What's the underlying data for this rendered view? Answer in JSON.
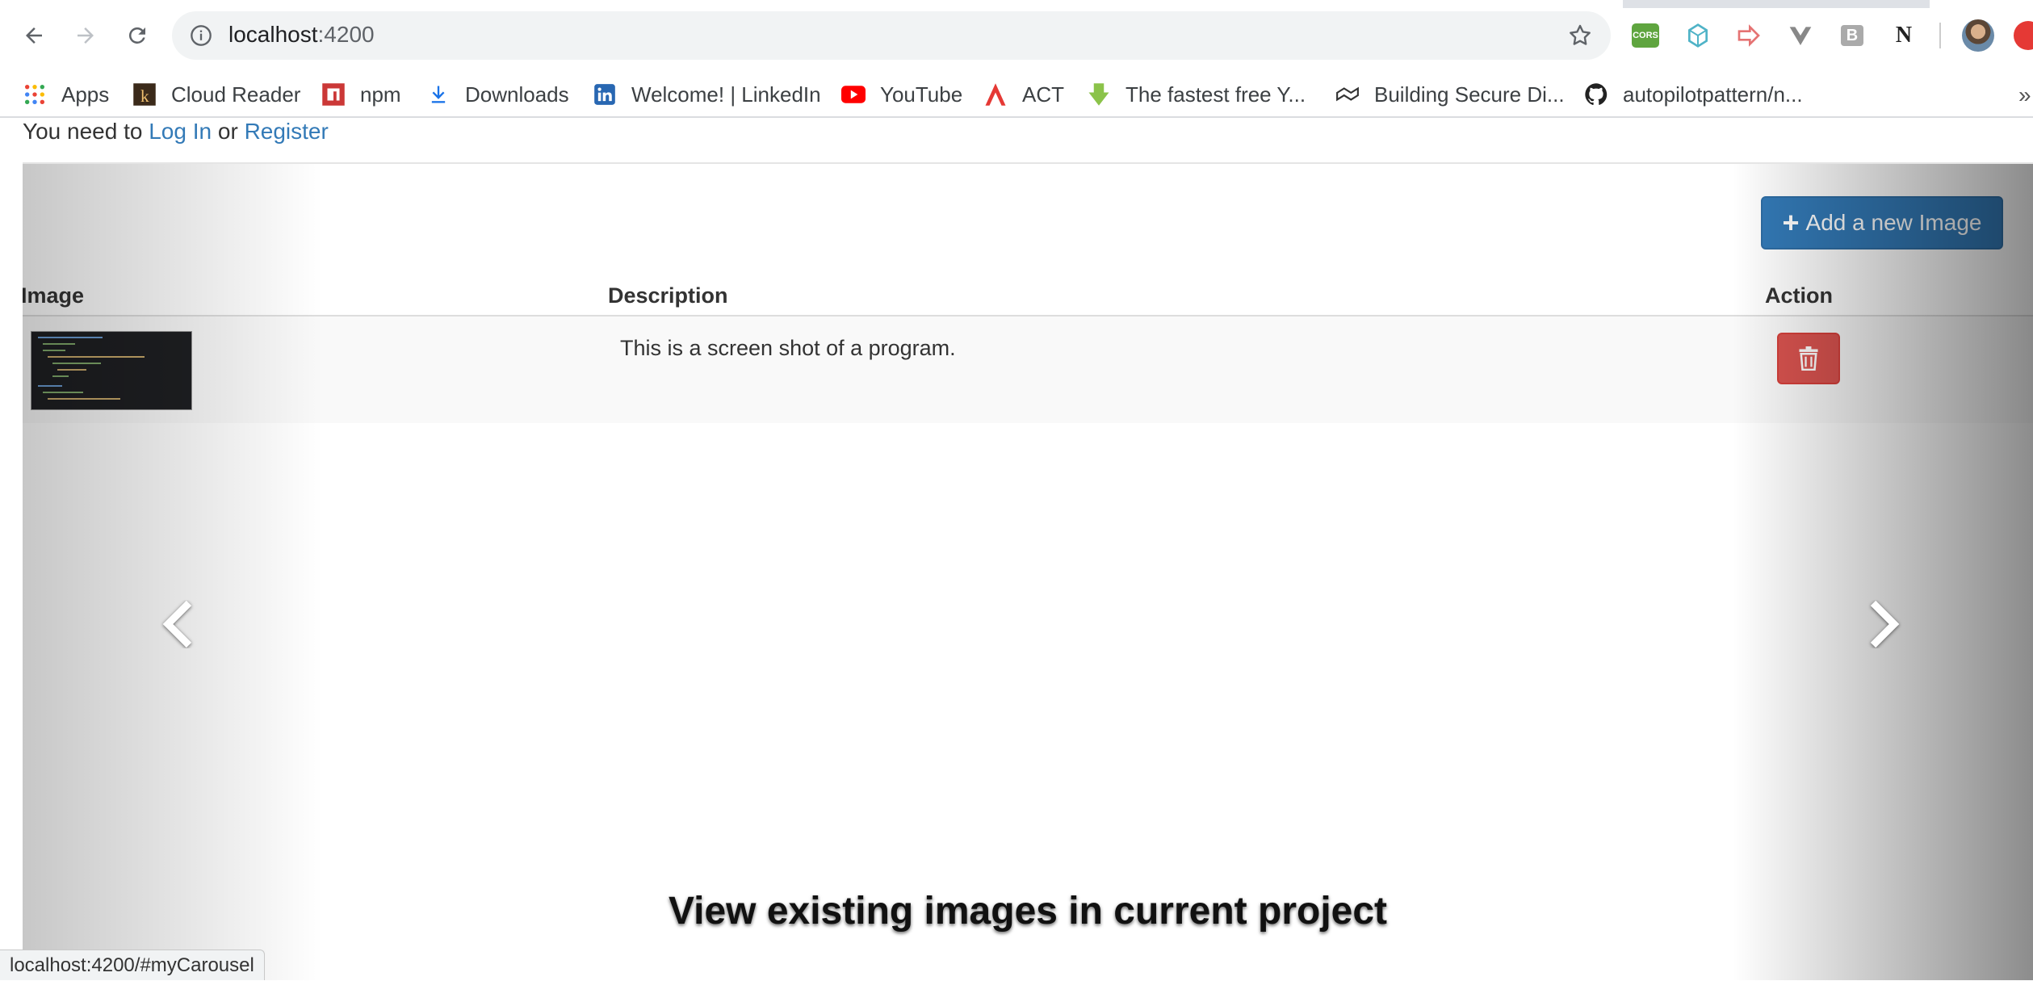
{
  "browser": {
    "url_host": "localhost",
    "url_port": ":4200",
    "bookmarks": [
      {
        "label": "Apps",
        "icon": "apps-grid-icon"
      },
      {
        "label": "Cloud Reader",
        "icon": "kindle-icon"
      },
      {
        "label": "npm",
        "icon": "npm-icon"
      },
      {
        "label": "Downloads",
        "icon": "download-icon"
      },
      {
        "label": "Welcome! | LinkedIn",
        "icon": "linkedin-icon"
      },
      {
        "label": "YouTube",
        "icon": "youtube-icon"
      },
      {
        "label": "ACT",
        "icon": "act-icon"
      },
      {
        "label": "The fastest free Y...",
        "icon": "download-arrow-icon"
      },
      {
        "label": "Building Secure Di...",
        "icon": "bookmark-site-icon"
      },
      {
        "label": "autopilotpattern/n...",
        "icon": "github-icon"
      }
    ],
    "more_bookmarks": "»",
    "extensions": {
      "cors": "CORS",
      "n": "N",
      "b": "B"
    },
    "status_url": "localhost:4200/#myCarousel"
  },
  "auth": {
    "prefix": "You need to",
    "login": "Log In",
    "middle": "or",
    "register": "Register"
  },
  "toolbar": {
    "add_label": "Add a new Image"
  },
  "table": {
    "columns": [
      "Image",
      "Description",
      "Action"
    ],
    "rows": [
      {
        "description": "This is a screen shot of a program."
      }
    ]
  },
  "carousel": {
    "caption": "View existing images in current project"
  },
  "colors": {
    "primary": "#337ab7",
    "danger": "#d9534f",
    "link": "#337ab7"
  }
}
